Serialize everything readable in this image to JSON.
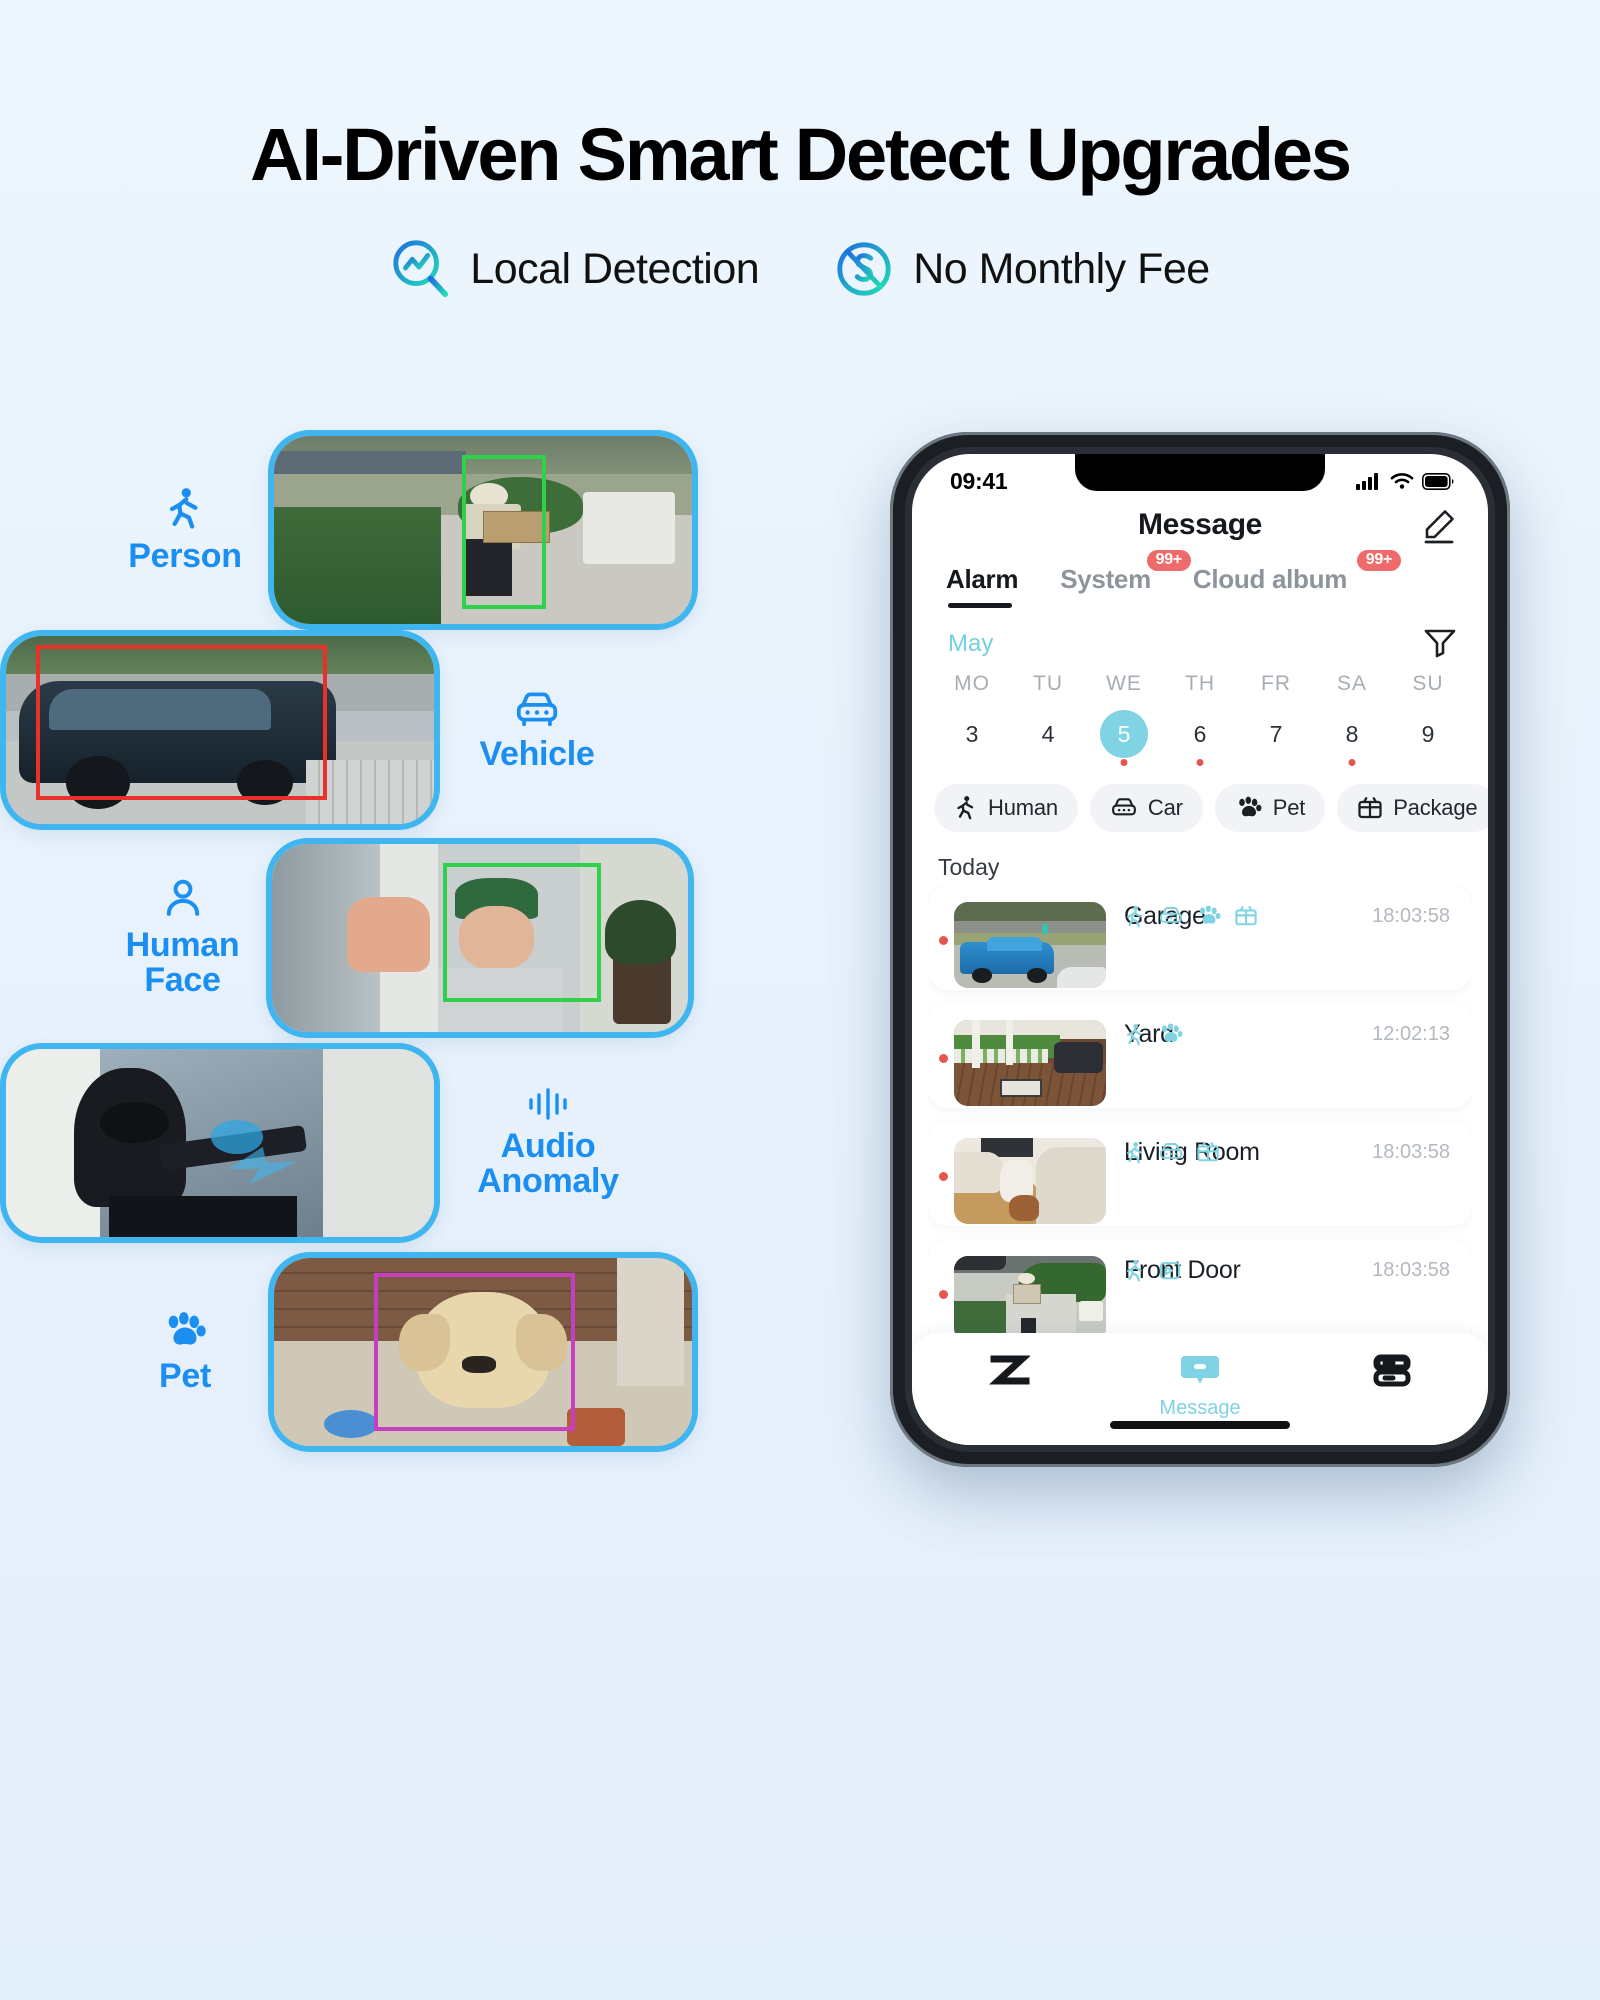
{
  "header": {
    "title": "AI-Driven Smart Detect Upgrades",
    "badges": [
      {
        "icon": "magnifier-activity-icon",
        "label": "Local Detection"
      },
      {
        "icon": "no-dollar-icon",
        "label": "No Monthly Fee"
      }
    ]
  },
  "colors": {
    "page_bg": "#eaf3fd",
    "label_blue": "#1b8ef2",
    "card_border": "#3fb6f0",
    "accent_teal": "#7fd3e2",
    "badge_red": "#ef6a6a",
    "unread_red": "#e4564e",
    "box_green": "#2fd04a",
    "box_red": "#e8312a",
    "box_magenta": "#c83ec0"
  },
  "features": [
    {
      "id": "person",
      "label": "Person",
      "icon": "walking-person-icon",
      "label_side": "left",
      "box_color": "#2fd04a",
      "scene": "delivery-person-driveway"
    },
    {
      "id": "vehicle",
      "label": "Vehicle",
      "icon": "car-front-icon",
      "label_side": "right",
      "box_color": "#e8312a",
      "scene": "car-in-driveway"
    },
    {
      "id": "face",
      "label": "Human\nFace",
      "icon": "person-head-icon",
      "label_side": "left",
      "box_color": "#2fd04a",
      "scene": "man-waving-doorway"
    },
    {
      "id": "audio",
      "label": "Audio\nAnomaly",
      "icon": "sound-wave-icon",
      "label_side": "right",
      "box_color": "",
      "scene": "burglar-breaking-window"
    },
    {
      "id": "pet",
      "label": "Pet",
      "icon": "paw-icon",
      "label_side": "left",
      "box_color": "#c83ec0",
      "scene": "golden-dog-porch"
    }
  ],
  "phone": {
    "status": {
      "time": "09:41",
      "signal": "cellular-bars-icon",
      "wifi": "wifi-icon",
      "battery": "battery-icon"
    },
    "app": {
      "title": "Message",
      "edit_icon": "pencil-edit-icon",
      "tabs": [
        {
          "label": "Alarm",
          "active": true,
          "badge": ""
        },
        {
          "label": "System",
          "active": false,
          "badge": "99+"
        },
        {
          "label": "Cloud album",
          "active": false,
          "badge": "99+"
        }
      ],
      "calendar": {
        "month": "May",
        "filter_icon": "funnel-filter-icon",
        "weekdays": [
          "MO",
          "TU",
          "WE",
          "TH",
          "FR",
          "SA",
          "SU"
        ],
        "days": [
          {
            "num": "3",
            "selected": false,
            "dot": false
          },
          {
            "num": "4",
            "selected": false,
            "dot": false
          },
          {
            "num": "5",
            "selected": true,
            "dot": true
          },
          {
            "num": "6",
            "selected": false,
            "dot": true
          },
          {
            "num": "7",
            "selected": false,
            "dot": false
          },
          {
            "num": "8",
            "selected": false,
            "dot": true
          },
          {
            "num": "9",
            "selected": false,
            "dot": false
          }
        ]
      },
      "chips": [
        {
          "label": "Human",
          "icon": "walking-person-icon"
        },
        {
          "label": "Car",
          "icon": "car-front-icon"
        },
        {
          "label": "Pet",
          "icon": "paw-icon"
        },
        {
          "label": "Package",
          "icon": "package-icon"
        }
      ],
      "section_label": "Today",
      "messages": [
        {
          "title": "Garage",
          "time": "18:03:58",
          "unread": true,
          "tags": [
            "walking-person-icon",
            "car-front-icon",
            "paw-icon",
            "package-icon"
          ],
          "scene": "blue-pickup-truck"
        },
        {
          "title": "Yard",
          "time": "12:02:13",
          "unread": true,
          "tags": [
            "walking-person-icon",
            "paw-icon"
          ],
          "scene": "covered-porch-deck"
        },
        {
          "title": "Living Room",
          "time": "18:03:58",
          "unread": true,
          "tags": [
            "walking-person-icon",
            "car-front-icon",
            "package-icon"
          ],
          "scene": "dog-on-sofa"
        },
        {
          "title": "Front Door",
          "time": "18:03:58",
          "unread": true,
          "tags": [
            "walking-person-icon",
            "delivery-box-icon"
          ],
          "scene": "courier-with-box"
        }
      ],
      "tabbar": [
        {
          "label": "",
          "icon": "z-logo-icon",
          "active": false
        },
        {
          "label": "Message",
          "icon": "chat-bubble-icon",
          "active": true
        },
        {
          "label": "",
          "icon": "device-icon",
          "active": false
        }
      ]
    }
  }
}
